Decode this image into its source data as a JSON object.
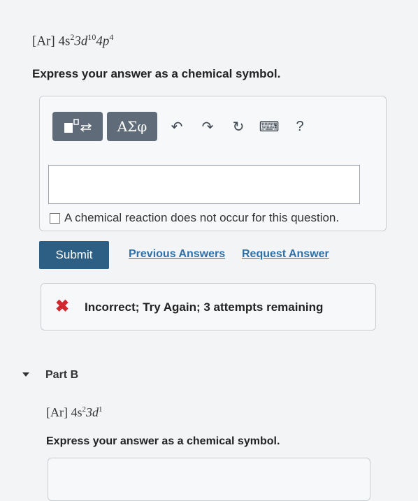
{
  "partA": {
    "config": {
      "core": "[Ar]",
      "s_orb": "4s",
      "s_exp": "2",
      "d_orb": "3d",
      "d_exp": "10",
      "p_orb": "4p",
      "p_exp": "4"
    },
    "instruction": "Express your answer as a chemical symbol.",
    "toolbar": {
      "symbols_label": "ΑΣφ",
      "undo_glyph": "↶",
      "redo_glyph": "↷",
      "reset_glyph": "↻",
      "keyboard_glyph": "⌨",
      "help_glyph": "?"
    },
    "answer": {
      "value": "",
      "placeholder": ""
    },
    "no_reaction_label": "A chemical reaction does not occur for this question.",
    "submit_label": "Submit",
    "previous_answers_label": "Previous Answers",
    "request_answer_label": "Request Answer",
    "feedback": {
      "icon": "✖",
      "message": "Incorrect; Try Again; 3 attempts remaining"
    }
  },
  "partB": {
    "title": "Part B",
    "config": {
      "core": "[Ar]",
      "s_orb": "4s",
      "s_exp": "2",
      "d_orb": "3d",
      "d_exp": "1"
    },
    "instruction": "Express your answer as a chemical symbol."
  },
  "colors": {
    "submit": "#2c5f83",
    "link": "#2f6fa7",
    "error": "#d0282e",
    "toolbar": "#5f6b78"
  },
  "icons": [
    "templates-icon",
    "greek-symbols-icon",
    "undo-icon",
    "redo-icon",
    "reset-icon",
    "keyboard-icon",
    "help-icon",
    "incorrect-x-icon",
    "caret-down-icon"
  ]
}
